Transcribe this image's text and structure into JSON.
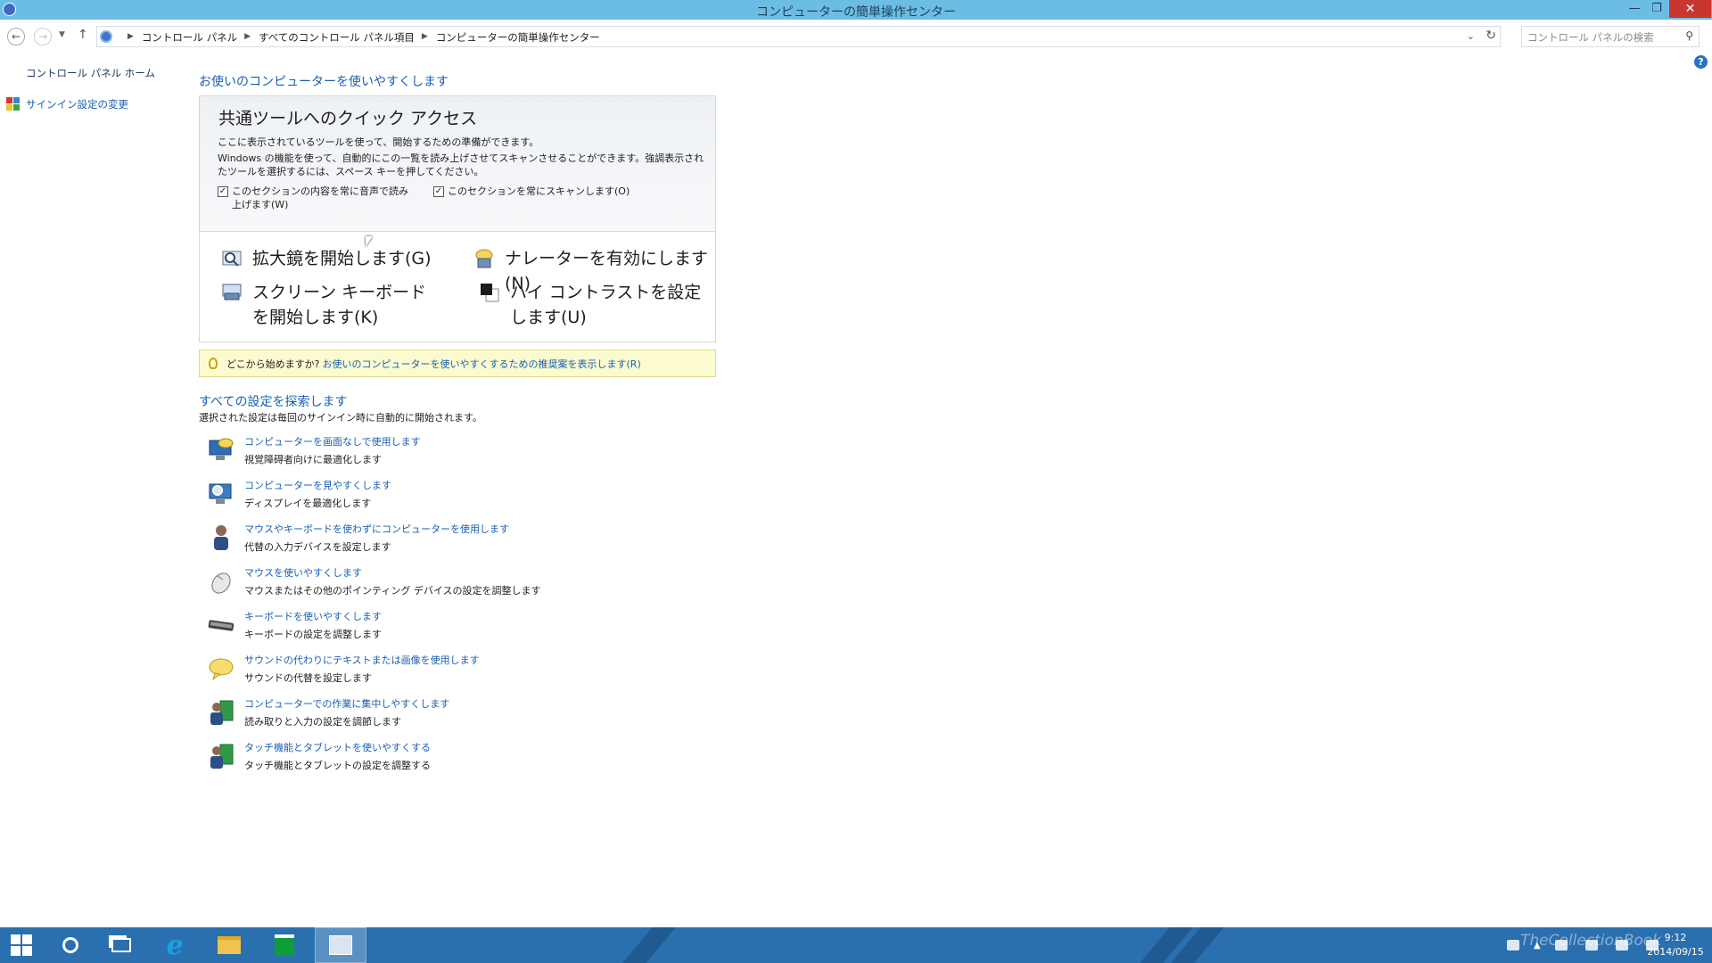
{
  "window": {
    "title": "コンピューターの簡単操作センター",
    "minimize_icon": "minimize-icon",
    "maximize_icon": "restore-icon",
    "close_icon": "close-icon"
  },
  "addressbar": {
    "back_icon": "back-arrow-icon",
    "forward_icon": "forward-arrow-icon",
    "up_icon": "up-arrow-icon",
    "breadcrumbs": [
      "コントロール パネル",
      "すべてのコントロール パネル項目",
      "コンピューターの簡単操作センター"
    ],
    "search_placeholder": "コントロール パネルの検索"
  },
  "leftnav": {
    "home_label": "コントロール パネル ホーム",
    "signin_label": "サインイン設定の変更"
  },
  "main": {
    "heading": "お使いのコンピューターを使いやすくします",
    "quick_access": {
      "title": "共通ツールへのクイック アクセス",
      "desc1": "ここに表示されているツールを使って、開始するための準備ができます。",
      "desc2": "Windows の機能を使って、自動的にこの一覧を読み上げさせてスキャンさせることができます。強調表示されたツールを選択するには、スペース キーを押してください。",
      "checkbox_read": "このセクションの内容を常に音声で読み上げます(W)",
      "checkbox_scan": "このセクションを常にスキャンします(O)",
      "tools": {
        "magnifier": "拡大鏡を開始します(G)",
        "narrator": "ナレーターを有効にします(N)",
        "keyboard": "スクリーン キーボードを開始します(K)",
        "contrast": "ハイ コントラストを設定します(U)"
      }
    },
    "tip": {
      "text": "どこから始めますか?",
      "link": "お使いのコンピューターを使いやすくするための推奨案を表示します(R)"
    },
    "explore": {
      "heading": "すべての設定を探索します",
      "subtitle": "選択された設定は毎回のサインイン時に自動的に開始されます。",
      "items": [
        {
          "title": "コンピューターを画面なしで使用します",
          "desc": "視覚障碍者向けに最適化します",
          "icon": "monitor-audio-icon"
        },
        {
          "title": "コンピューターを見やすくします",
          "desc": "ディスプレイを最適化します",
          "icon": "monitor-magnify-icon"
        },
        {
          "title": "マウスやキーボードを使わずにコンピューターを使用します",
          "desc": "代替の入力デバイスを設定します",
          "icon": "person-icon"
        },
        {
          "title": "マウスを使いやすくします",
          "desc": "マウスまたはその他のポインティング デバイスの設定を調整します",
          "icon": "mouse-icon"
        },
        {
          "title": "キーボードを使いやすくします",
          "desc": "キーボードの設定を調整します",
          "icon": "keyboard-icon"
        },
        {
          "title": "サウンドの代わりにテキストまたは画像を使用します",
          "desc": "サウンドの代替を設定します",
          "icon": "speech-bubble-icon"
        },
        {
          "title": "コンピューターでの作業に集中しやすくします",
          "desc": "読み取りと入力の設定を調節します",
          "icon": "people-icon"
        },
        {
          "title": "タッチ機能とタブレットを使いやすくする",
          "desc": "タッチ機能とタブレットの設定を調整する",
          "icon": "tablet-user-icon"
        }
      ]
    }
  },
  "taskbar": {
    "clock_time": "9:12",
    "clock_date": "2014/09/15",
    "watermark": "TheCollectionBook"
  },
  "colors": {
    "titlebar": "#6cbde3",
    "link": "#1a5fb4",
    "taskbar": "#2a6fae",
    "tip_bg": "#fcfbd0"
  }
}
